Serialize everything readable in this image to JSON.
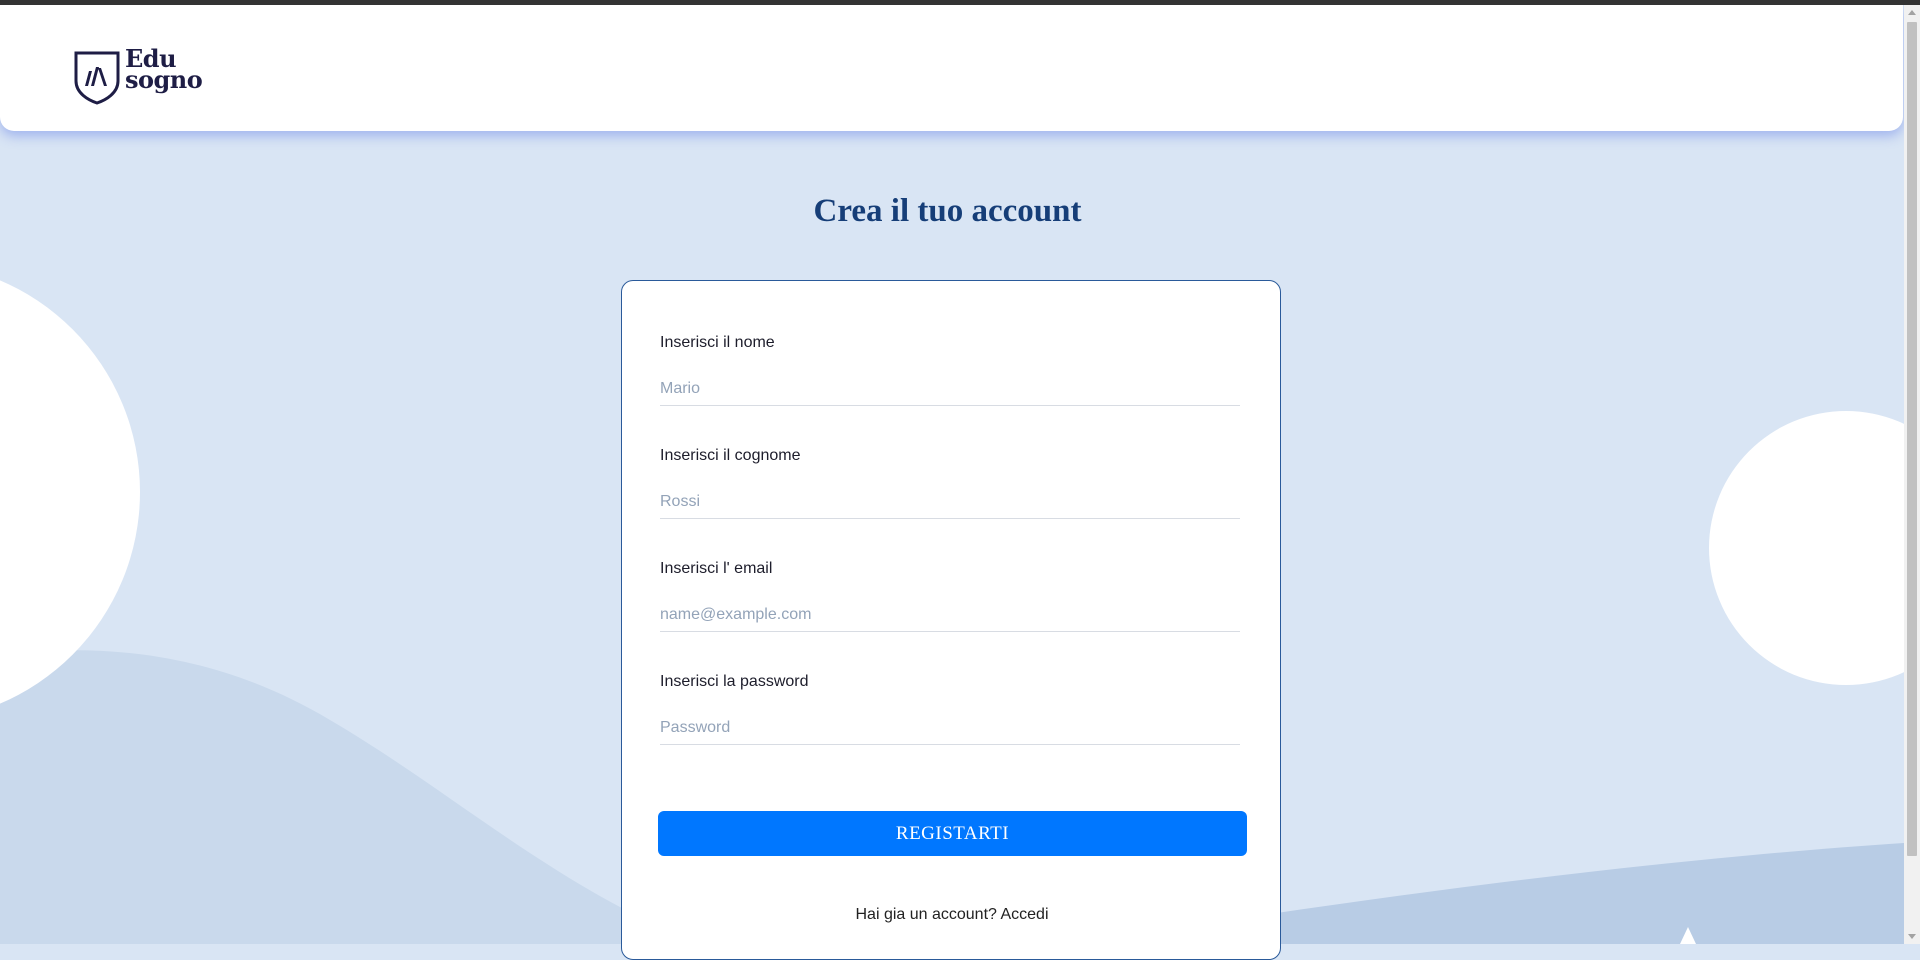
{
  "header": {
    "logo_line1": "Edu",
    "logo_line2": "sogno"
  },
  "page_title": "Crea il tuo account",
  "form": {
    "fields": [
      {
        "label": "Inserisci il nome",
        "placeholder": "Mario",
        "value": ""
      },
      {
        "label": "Inserisci il cognome",
        "placeholder": "Rossi",
        "value": ""
      },
      {
        "label": "Inserisci l' email",
        "placeholder": "name@example.com",
        "value": ""
      },
      {
        "label": "Inserisci la password",
        "placeholder": "Password",
        "value": ""
      }
    ],
    "submit_label": "REGISTARTI",
    "login_prompt": "Hai gia un account?",
    "login_link": "Accedi"
  },
  "colors": {
    "background": "#d9e5f4",
    "title": "#163e78",
    "button": "#0077ff",
    "logo": "#1e1d45"
  }
}
